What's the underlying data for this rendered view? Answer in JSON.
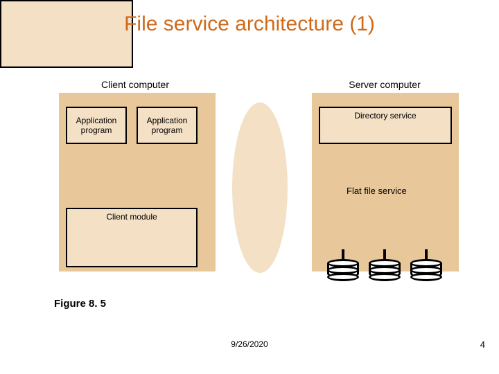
{
  "title": "File service architecture (1)",
  "labels": {
    "client_computer": "Client computer",
    "server_computer": "Server computer"
  },
  "boxes": {
    "app1": "Application\nprogram",
    "app2": "Application\nprogram",
    "client_module": "Client module",
    "directory_service": "Directory service",
    "flat_file_service": "Flat file service"
  },
  "caption": "Figure 8. 5",
  "footer": {
    "date": "9/26/2020",
    "page": "4"
  },
  "colors": {
    "title": "#cf6a1a",
    "panel": "#e8c79a",
    "box_fill": "#f3e0c5"
  }
}
